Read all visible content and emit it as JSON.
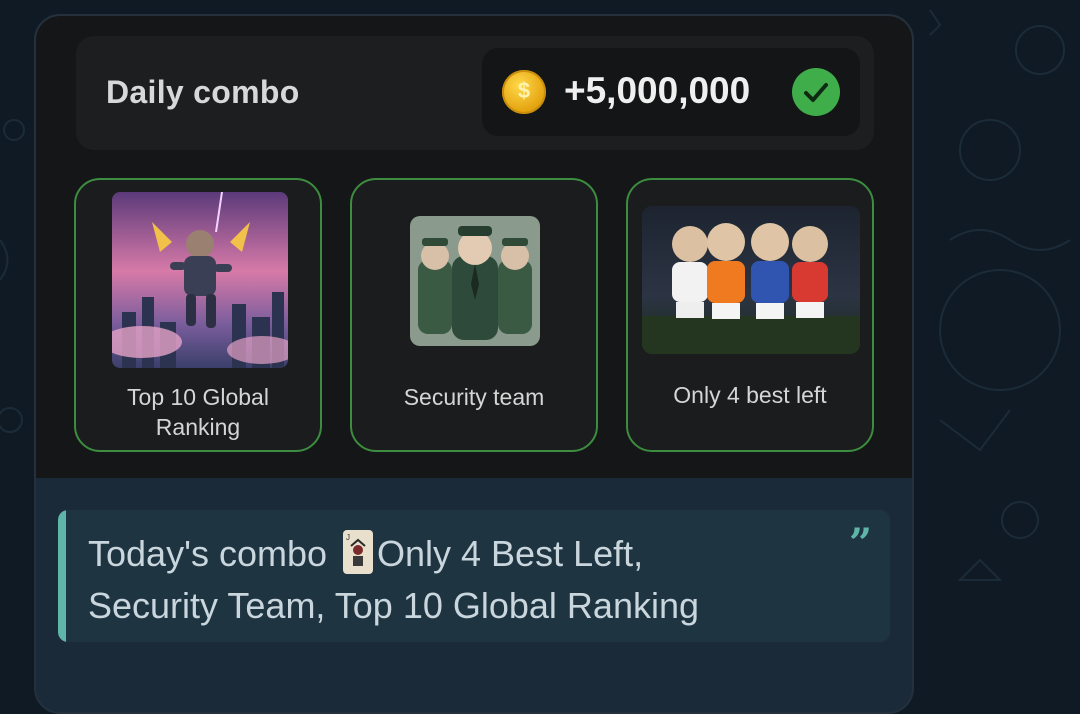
{
  "combo": {
    "title": "Daily combo",
    "reward": "+5,000,000",
    "coin_symbol": "$",
    "cards": [
      {
        "label_line1": "Top 10 Global",
        "label_line2": "Ranking",
        "image": "hamster-flying-over-city"
      },
      {
        "label_line1": "Security team",
        "label_line2": "",
        "image": "hamster-security-guards"
      },
      {
        "label_line1": "Only 4 best left",
        "label_line2": "",
        "image": "hamster-football-team"
      }
    ]
  },
  "message": {
    "text_before_icon": "Today's combo ",
    "icon": "joker-card-icon",
    "text_after_icon": "Only 4 Best Left,",
    "line2": "Security Team, Top 10 Global Ranking",
    "quote_mark": "”"
  },
  "colors": {
    "accent_green": "#3c8d3f",
    "check_green": "#3fae4a",
    "quote_accent": "#5fb6a8",
    "coin_gold": "#e3a10e"
  }
}
